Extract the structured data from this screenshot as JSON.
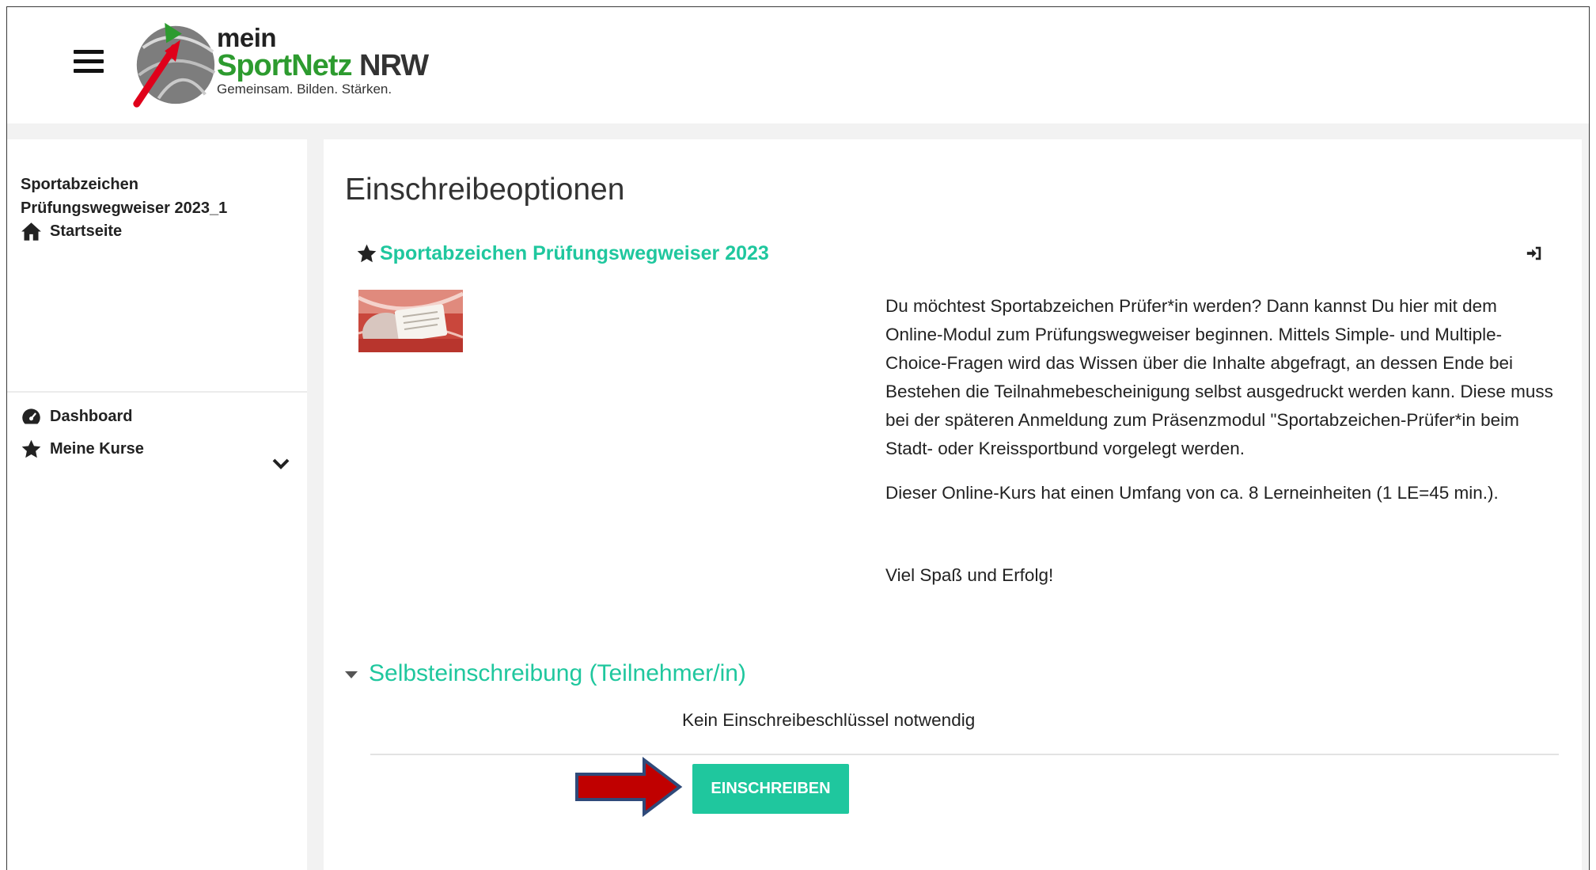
{
  "header": {
    "logo": {
      "mein": "mein",
      "name_green": "SportNetz",
      "name_dark": "NRW",
      "tagline": "Gemeinsam. Bilden. Stärken."
    }
  },
  "sidebar": {
    "course_title": "Sportabzeichen Prüfungswegweiser 2023_1",
    "items": [
      {
        "label": "Startseite",
        "icon": "home-icon"
      },
      {
        "label": "Dashboard",
        "icon": "dashboard-icon"
      },
      {
        "label": "Meine Kurse",
        "icon": "star-icon"
      }
    ]
  },
  "main": {
    "title": "Einschreibeoptionen",
    "course_name": "Sportabzeichen Prüfungswegweiser 2023",
    "summary": [
      "Du möchtest  Sportabzeichen Prüfer*in werden? Dann kannst Du hier mit dem Online-Modul zum Prüfungswegweiser beginnen. Mittels Simple- und Multiple-Choice-Fragen wird das Wissen über die Inhalte abgefragt, an dessen Ende bei Bestehen die Teilnahmebescheinigung selbst ausgedruckt werden kann. Diese muss bei der späteren Anmeldung zum Präsenzmodul \"Sportabzeichen-Prüfer*in beim Stadt- oder Kreissportbund vorgelegt werden.",
      "Dieser Online-Kurs hat einen Umfang von ca. 8 Lerneinheiten (1 LE=45 min.).",
      "Viel Spaß und Erfolg!"
    ],
    "enrol_section": "Selbsteinschreibung (Teilnehmer/in)",
    "no_key_text": "Kein Einschreibeschlüssel notwendig",
    "enrol_button": "EINSCHREIBEN"
  },
  "colors": {
    "accent": "#1fc79e",
    "arrow": "#c00000",
    "arrow_border": "#2f4a7a"
  }
}
